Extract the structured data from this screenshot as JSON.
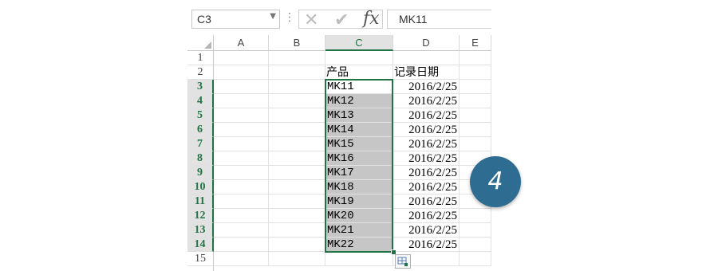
{
  "formula_bar": {
    "name_box": "C3",
    "cancel_icon": "cross-icon",
    "enter_icon": "check-icon",
    "fx_label": "fx",
    "value": "MK11"
  },
  "columns": [
    "A",
    "B",
    "C",
    "D",
    "E"
  ],
  "selected_column": "C",
  "rows": [
    {
      "num": "1",
      "c": "",
      "d": ""
    },
    {
      "num": "2",
      "c": "产品",
      "d": "记录日期"
    },
    {
      "num": "3",
      "c": "MK11",
      "d": "2016/2/25"
    },
    {
      "num": "4",
      "c": "MK12",
      "d": "2016/2/25"
    },
    {
      "num": "5",
      "c": "MK13",
      "d": "2016/2/25"
    },
    {
      "num": "6",
      "c": "MK14",
      "d": "2016/2/25"
    },
    {
      "num": "7",
      "c": "MK15",
      "d": "2016/2/25"
    },
    {
      "num": "8",
      "c": "MK16",
      "d": "2016/2/25"
    },
    {
      "num": "9",
      "c": "MK17",
      "d": "2016/2/25"
    },
    {
      "num": "10",
      "c": "MK18",
      "d": "2016/2/25"
    },
    {
      "num": "11",
      "c": "MK19",
      "d": "2016/2/25"
    },
    {
      "num": "12",
      "c": "MK20",
      "d": "2016/2/25"
    },
    {
      "num": "13",
      "c": "MK21",
      "d": "2016/2/25"
    },
    {
      "num": "14",
      "c": "MK22",
      "d": "2016/2/25"
    },
    {
      "num": "15",
      "c": "",
      "d": ""
    }
  ],
  "selected_rows": [
    "3",
    "4",
    "5",
    "6",
    "7",
    "8",
    "9",
    "10",
    "11",
    "12",
    "13",
    "14"
  ],
  "step_badge": "4",
  "colors": {
    "accent": "#217346",
    "badge": "#2e6d91",
    "selection_fill": "#c6c6c6"
  }
}
